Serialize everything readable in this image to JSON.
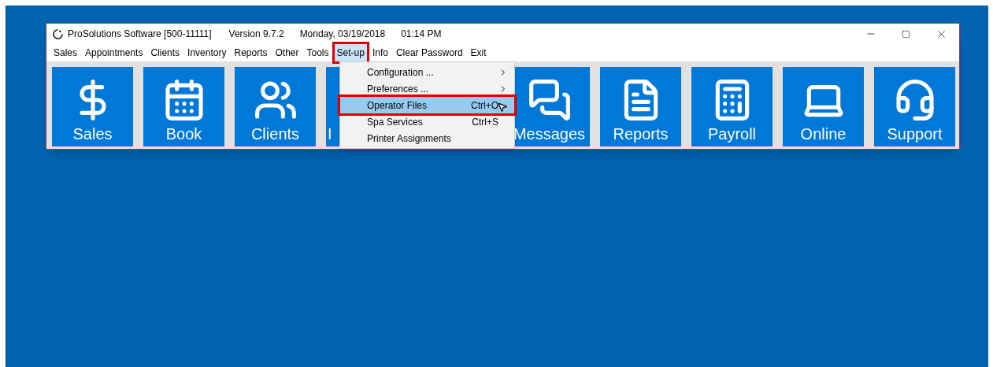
{
  "window": {
    "title": "ProSolutions Software [500-11111]",
    "version": "Version 9.7.2",
    "date": "Monday, 03/19/2018",
    "time": "01:14 PM"
  },
  "menu_bar": [
    {
      "label": "Sales",
      "selected": false,
      "highlighted": false
    },
    {
      "label": "Appointments",
      "selected": false,
      "highlighted": false
    },
    {
      "label": "Clients",
      "selected": false,
      "highlighted": false
    },
    {
      "label": "Inventory",
      "selected": false,
      "highlighted": false
    },
    {
      "label": "Reports",
      "selected": false,
      "highlighted": false
    },
    {
      "label": "Other",
      "selected": false,
      "highlighted": false
    },
    {
      "label": "Tools",
      "selected": false,
      "highlighted": false
    },
    {
      "label": "Set-up",
      "selected": true,
      "highlighted": true
    },
    {
      "label": "Info",
      "selected": false,
      "highlighted": false
    },
    {
      "label": "Clear Password",
      "selected": false,
      "highlighted": false
    },
    {
      "label": "Exit",
      "selected": false,
      "highlighted": false
    }
  ],
  "dropdown": [
    {
      "label": "Configuration ...",
      "submenu": true,
      "selected": false,
      "highlighted": false
    },
    {
      "label": "Preferences ...",
      "submenu": true,
      "selected": false,
      "highlighted": false
    },
    {
      "label": "Operator Files",
      "shortcut": "Ctrl+O",
      "submenu": false,
      "selected": true,
      "highlighted": true
    },
    {
      "label": "Spa Services",
      "shortcut": "Ctrl+S",
      "submenu": false,
      "selected": false,
      "highlighted": false
    },
    {
      "label": "Printer Assignments",
      "submenu": false,
      "selected": false,
      "highlighted": false
    }
  ],
  "tiles": [
    {
      "kind": "dollar",
      "label": "Sales"
    },
    {
      "kind": "calendar",
      "label": "Book"
    },
    {
      "kind": "people",
      "label": "Clients"
    },
    {
      "kind": "cut",
      "label": "I"
    },
    {
      "kind": "chat",
      "label": "Messages"
    },
    {
      "kind": "report",
      "label": "Reports"
    },
    {
      "kind": "calculator",
      "label": "Payroll"
    },
    {
      "kind": "laptop",
      "label": "Online"
    },
    {
      "kind": "headset",
      "label": "Support"
    }
  ]
}
